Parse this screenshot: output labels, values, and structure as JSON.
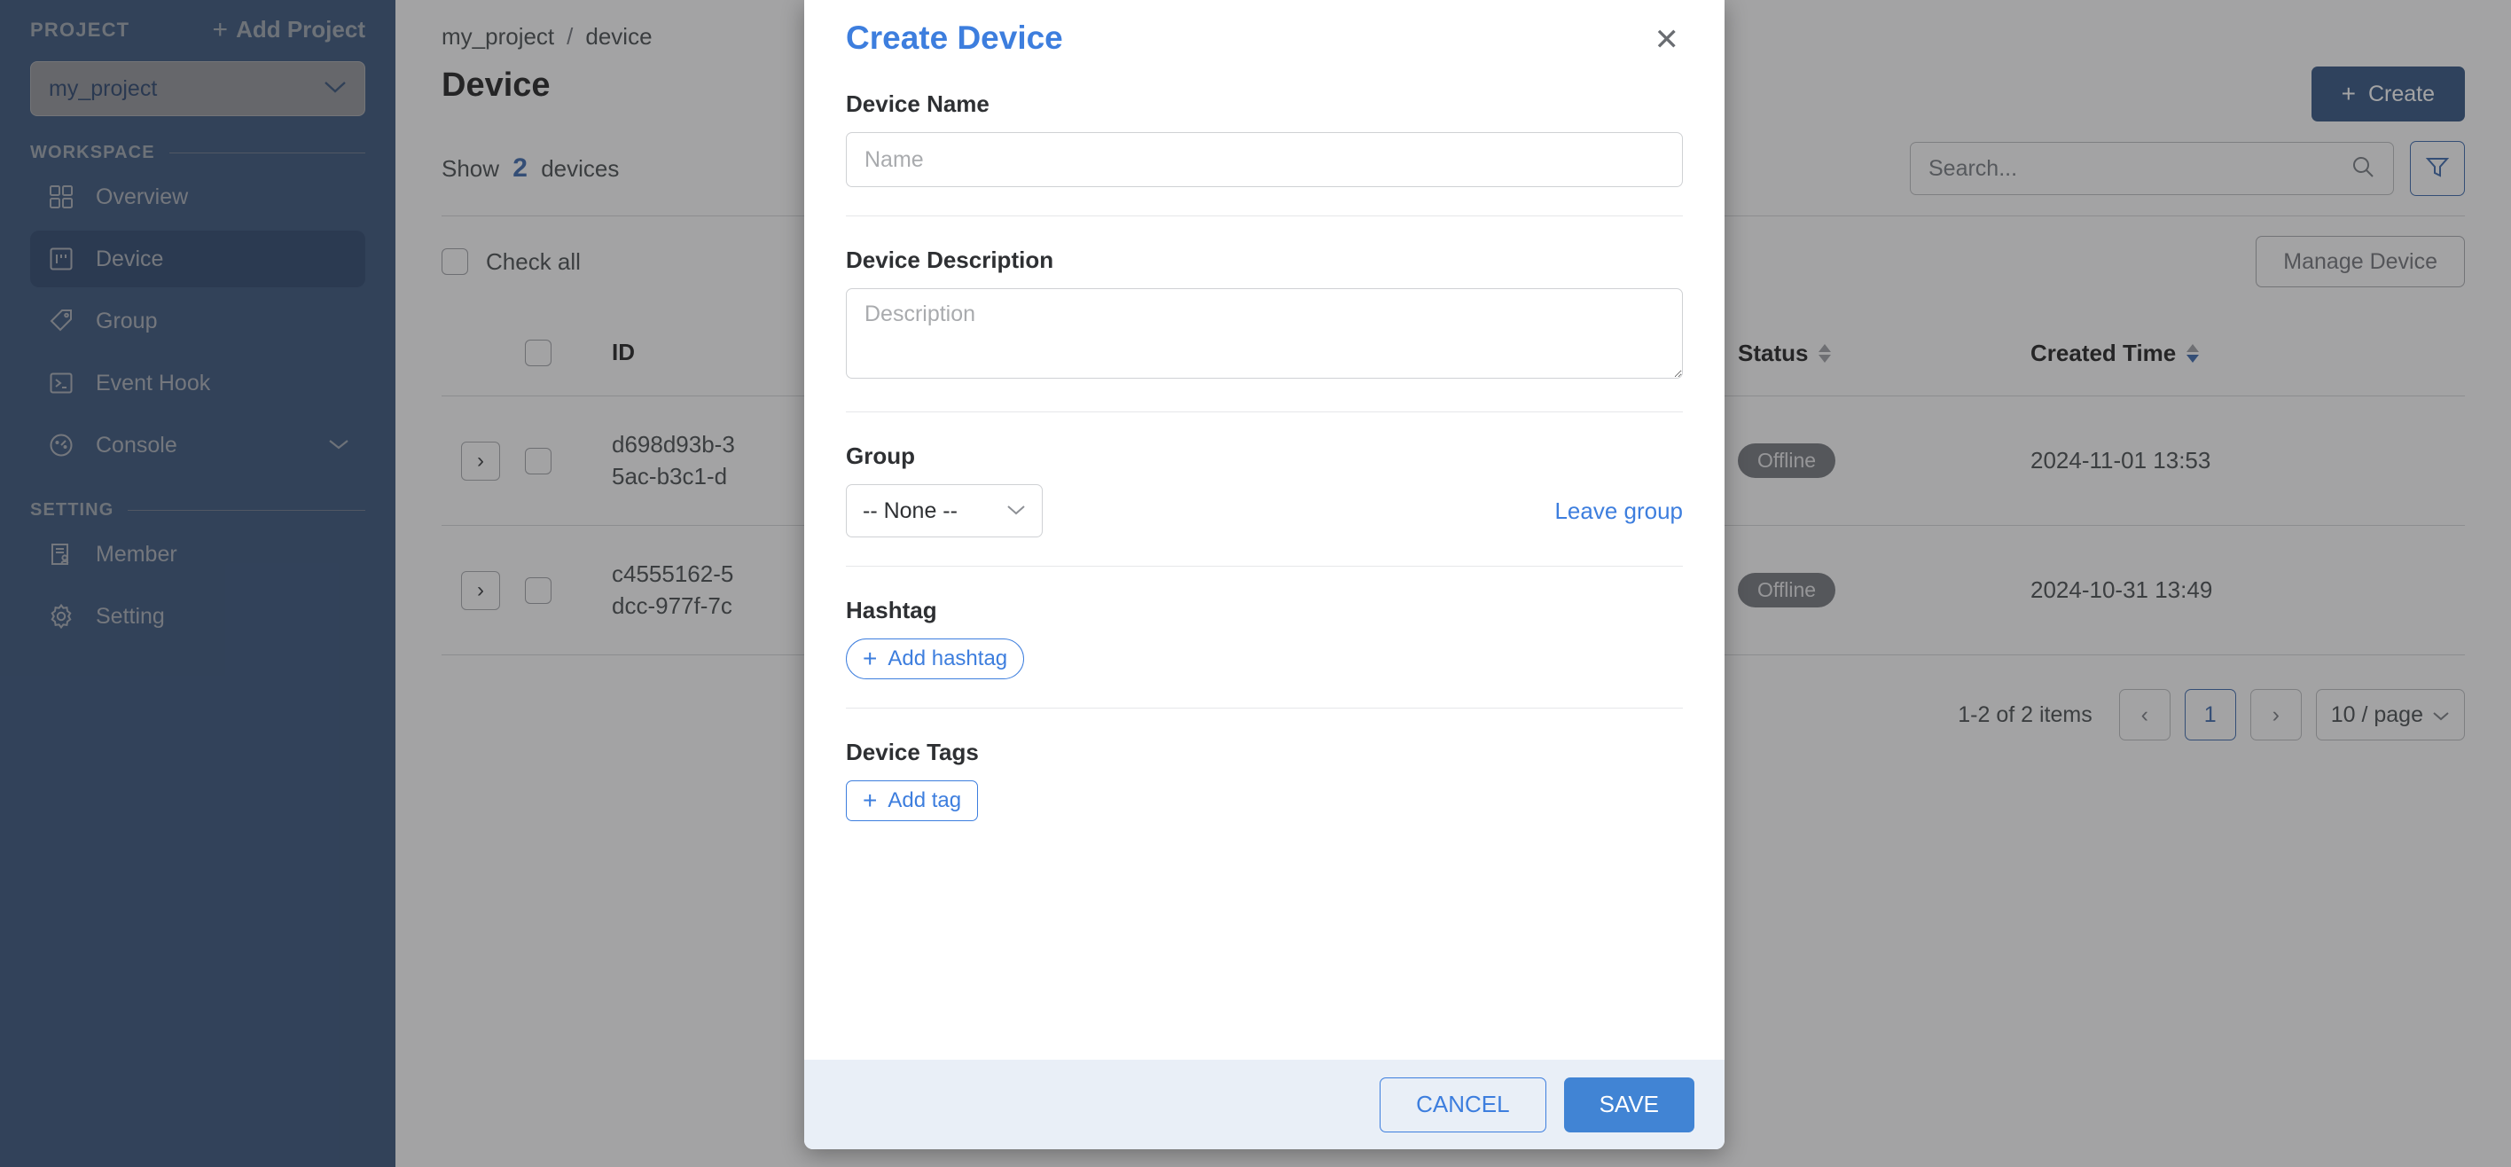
{
  "sidebar": {
    "project_kicker": "PROJECT",
    "add_project_label": "Add Project",
    "selected_project": "my_project",
    "sections": [
      {
        "label": "WORKSPACE"
      },
      {
        "label": "SETTING"
      }
    ],
    "workspace_items": [
      {
        "label": "Overview",
        "icon": "grid-icon",
        "active": false,
        "expandable": false
      },
      {
        "label": "Device",
        "icon": "device-icon",
        "active": true,
        "expandable": false
      },
      {
        "label": "Group",
        "icon": "tag-icon",
        "active": false,
        "expandable": false
      },
      {
        "label": "Event Hook",
        "icon": "terminal-icon",
        "active": false,
        "expandable": false
      },
      {
        "label": "Console",
        "icon": "gauge-icon",
        "active": false,
        "expandable": true
      }
    ],
    "setting_items": [
      {
        "label": "Member",
        "icon": "member-icon"
      },
      {
        "label": "Setting",
        "icon": "gear-icon"
      }
    ]
  },
  "main": {
    "breadcrumb": {
      "root": "my_project",
      "separator": "/",
      "current": "device"
    },
    "page_title": "Device",
    "create_button": "Create",
    "search_placeholder": "Search...",
    "show_prefix": "Show",
    "show_count": "2",
    "show_suffix": "devices",
    "check_all_label": "Check all",
    "manage_device_button": "Manage Device",
    "columns": [
      "ID",
      "Status",
      "Created Time"
    ],
    "rows": [
      {
        "id_line1": "d698d93b-3",
        "id_line2": "5ac-b3c1-d",
        "status": "Offline",
        "created": "2024-11-01 13:53"
      },
      {
        "id_line1": "c4555162-5",
        "id_line2": "dcc-977f-7c",
        "status": "Offline",
        "created": "2024-10-31 13:49"
      }
    ],
    "pagination": {
      "info": "1-2 of 2 items",
      "prev": "‹",
      "current_page": "1",
      "next": "›",
      "page_size": "10 / page"
    }
  },
  "modal": {
    "title": "Create Device",
    "close_icon": "✕",
    "fields": {
      "device_name_label": "Device Name",
      "device_name_value": "",
      "device_name_placeholder": "Name",
      "device_description_label": "Device Description",
      "device_description_value": "",
      "device_description_placeholder": "Description",
      "group_label": "Group",
      "group_value": "-- None --",
      "leave_group_link": "Leave group",
      "hashtag_label": "Hashtag",
      "add_hashtag_button": "Add hashtag",
      "device_tags_label": "Device Tags",
      "add_tag_button": "Add tag"
    },
    "footer": {
      "cancel": "CANCEL",
      "save": "SAVE"
    }
  },
  "colors": {
    "sidebar_bg": "#2a4872",
    "sidebar_active": "#1d3a63",
    "accent_blue": "#3d7ede",
    "primary_navy": "#254979",
    "save_blue": "#4184d4",
    "footer_bg": "#e9eff7",
    "overlay": "rgba(60,60,62,0.47)"
  }
}
